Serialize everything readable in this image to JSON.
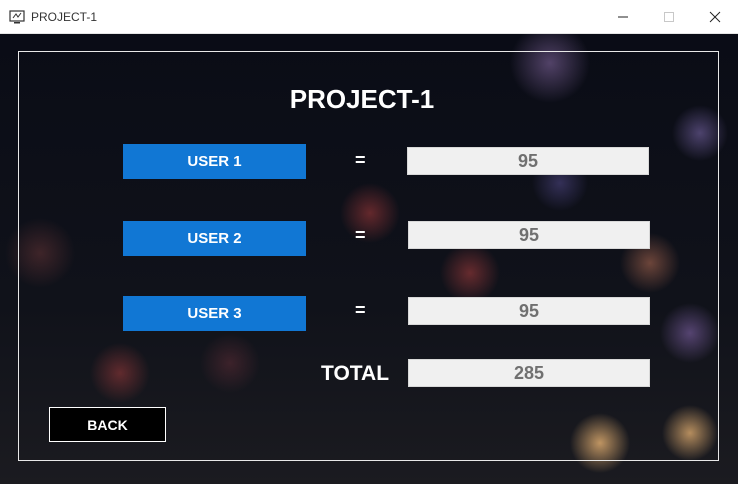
{
  "window": {
    "title": "PROJECT-1",
    "icon": "monitor-app-icon"
  },
  "main": {
    "heading": "PROJECT-1",
    "rows": [
      {
        "label": "USER 1",
        "equals": "=",
        "value": "95"
      },
      {
        "label": "USER 2",
        "equals": "=",
        "value": "95"
      },
      {
        "label": "USER 3",
        "equals": "=",
        "value": "95"
      }
    ],
    "total": {
      "label": "TOTAL",
      "value": "285"
    },
    "back_label": "BACK"
  },
  "colors": {
    "accent": "#1177d4",
    "field_bg": "#f0f0f0",
    "field_text": "#707070"
  }
}
